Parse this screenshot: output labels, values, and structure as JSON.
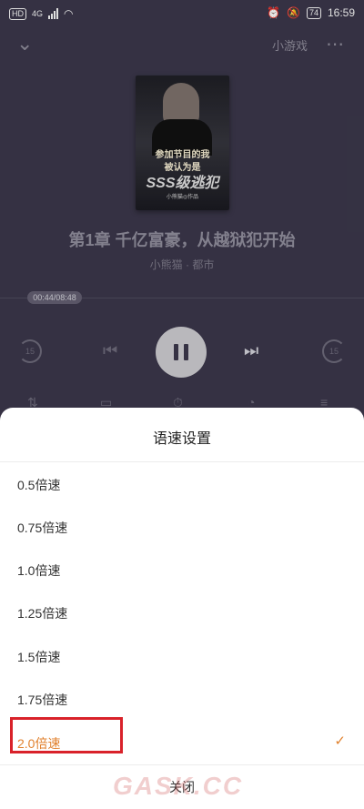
{
  "status": {
    "left_badge": "HD",
    "net": "4G",
    "battery": "74",
    "time": "16:59"
  },
  "topbar": {
    "mini_game": "小游戏",
    "more": "⋯"
  },
  "cover": {
    "line1": "参加节目的我",
    "line2": "被认为是",
    "line3": "SSS级逃犯",
    "line4": "小熊猫◎作品"
  },
  "player": {
    "chapter_title": "第1章 千亿富豪，从越狱犯开始",
    "author_category": "小熊猫 · 都市",
    "time": "00:44/08:48",
    "rewind": "15",
    "forward": "15"
  },
  "sheet": {
    "title": "语速设置",
    "options": [
      "0.5倍速",
      "0.75倍速",
      "1.0倍速",
      "1.25倍速",
      "1.5倍速",
      "1.75倍速",
      "2.0倍速"
    ],
    "selected_index": 6,
    "check": "✓",
    "close": "关闭"
  },
  "watermark": "GASK.CC",
  "colors": {
    "accent": "#e1822f",
    "highlight": "#d9222a",
    "player_bg": "#3a3649"
  }
}
